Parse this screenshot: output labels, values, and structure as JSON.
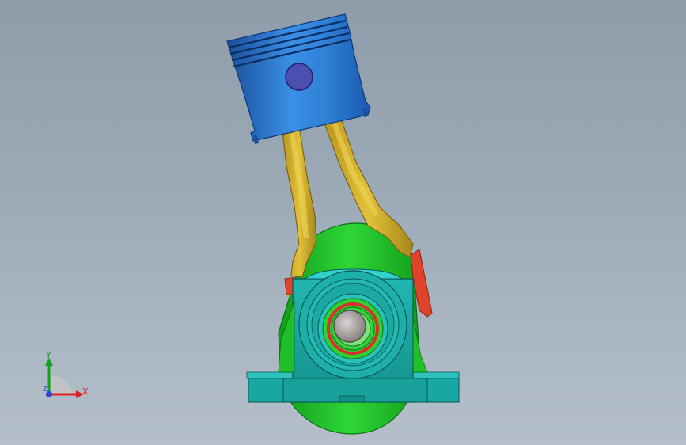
{
  "triad": {
    "x_label": "X",
    "y_label": "Y",
    "z_label": "Z"
  },
  "colors": {
    "background_top": "#8f9dab",
    "background_bottom": "#b4bfca",
    "piston": "#2f7fd6",
    "piston_pin": "#4a4fb0",
    "rods": "#d9b62a",
    "crank_web": "#22c22a",
    "bearing_block": "#19a7a2",
    "counterweight": "#e0432a",
    "shaft": "#b8b0b0"
  }
}
